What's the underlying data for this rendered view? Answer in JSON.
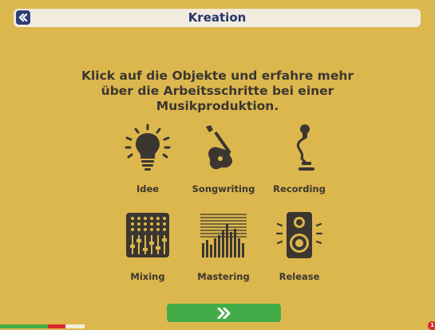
{
  "header": {
    "title": "Kreation",
    "back_icon": "double-chevron-left-icon"
  },
  "intro_text": "Klick auf die Objekte und erfahre mehr über die Arbeitsschritte bei einer Musikproduktion.",
  "objects": [
    {
      "label": "Idee",
      "icon": "lightbulb-icon"
    },
    {
      "label": "Songwriting",
      "icon": "guitar-icon"
    },
    {
      "label": "Recording",
      "icon": "microphone-icon"
    },
    {
      "label": "Mixing",
      "icon": "mixing-console-icon"
    },
    {
      "label": "Mastering",
      "icon": "equalizer-icon"
    },
    {
      "label": "Release",
      "icon": "speaker-icon"
    }
  ],
  "next_button": {
    "icon": "double-chevron-right-icon"
  },
  "notification_badge": "1",
  "colors": {
    "background": "#dcb74d",
    "title_bar": "#f2ebdf",
    "title_text": "#26366d",
    "icon_dark": "#3b3630",
    "next_button": "#42ad48",
    "badge": "#d8282c"
  }
}
